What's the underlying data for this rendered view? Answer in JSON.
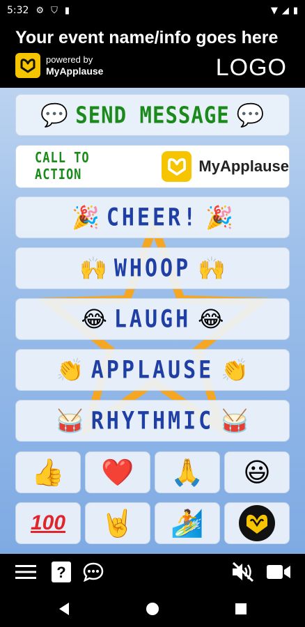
{
  "status_bar": {
    "time": "5:32"
  },
  "header": {
    "event_title": "Your event name/info goes here",
    "powered_by": "powered by",
    "brand": "MyApplause",
    "logo_text": "LOGO"
  },
  "buttons": {
    "send_message": {
      "label": "SEND MESSAGE",
      "emoji": "💬"
    },
    "call_to_action": {
      "label": "CALL TO ACTION",
      "brand": "MyApplause"
    },
    "cheer": {
      "label": "CHEER!",
      "emoji": "🎉"
    },
    "whoop": {
      "label": "WHOOP",
      "emoji": "🙌"
    },
    "laugh": {
      "label": "LAUGH",
      "emoji": "😂"
    },
    "applause": {
      "label": "APPLAUSE",
      "emoji": "👏"
    },
    "rhythmic": {
      "label": "RHYTHMIC",
      "emoji": "🥁"
    }
  },
  "emoji_grid": [
    {
      "name": "thumbs-up",
      "emoji": "👍"
    },
    {
      "name": "heart",
      "emoji": "❤️"
    },
    {
      "name": "praying-hands",
      "emoji": "🙏"
    },
    {
      "name": "smiley",
      "emoji": "😃"
    },
    {
      "name": "hundred",
      "emoji": "100"
    },
    {
      "name": "rock-on",
      "emoji": "🤘"
    },
    {
      "name": "surfer",
      "emoji": "🏄"
    },
    {
      "name": "heart-hands-logo",
      "emoji": ""
    }
  ],
  "colors": {
    "brand_yellow": "#f7c400",
    "label_blue": "#1f3fa5",
    "label_green": "#1a8a1a",
    "star_orange": "#f5a623"
  }
}
